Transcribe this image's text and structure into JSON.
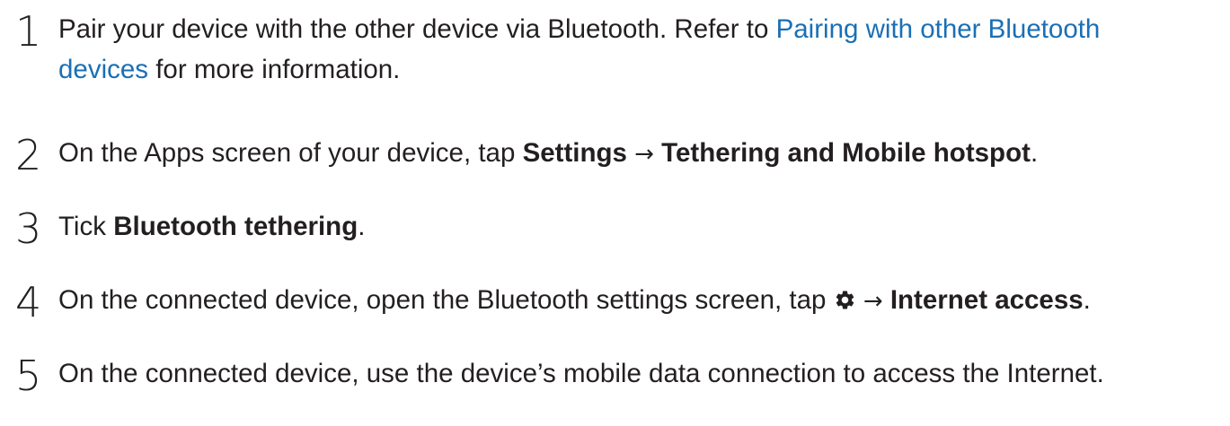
{
  "steps": [
    {
      "number": "1",
      "line1_before": "Pair your device with the other device via Bluetooth. Refer to ",
      "line1_link": "Pairing with other Bluetooth",
      "line2_link": "devices",
      "line2_after": " for more information."
    },
    {
      "number": "2",
      "before": "On the Apps screen of your device, tap ",
      "bold1": "Settings",
      "arrow": "→",
      "bold2": "Tethering and Mobile hotspot",
      "after": "."
    },
    {
      "number": "3",
      "before": "Tick ",
      "bold1": "Bluetooth tethering",
      "after": "."
    },
    {
      "number": "4",
      "before": "On the connected device, open the Bluetooth settings screen, tap ",
      "icon": "gear-icon",
      "arrow": "→",
      "bold1": "Internet access",
      "after": "."
    },
    {
      "number": "5",
      "text": "On the connected device, use the device’s mobile data connection to access the Internet."
    }
  ],
  "colors": {
    "text": "#231f20",
    "link": "#1a6fb5"
  }
}
